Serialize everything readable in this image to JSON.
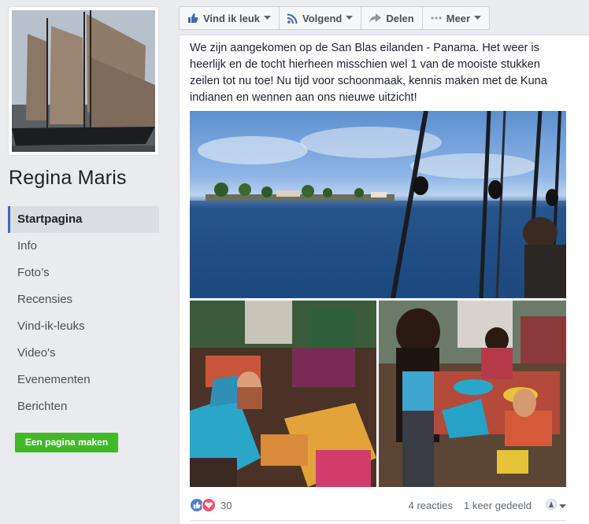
{
  "page": {
    "name": "Regina Maris"
  },
  "sidebar": {
    "items": [
      {
        "label": "Startpagina",
        "active": true
      },
      {
        "label": "Info"
      },
      {
        "label": "Foto’s"
      },
      {
        "label": "Recensies"
      },
      {
        "label": "Vind-ik-leuks"
      },
      {
        "label": "Video's"
      },
      {
        "label": "Evenementen"
      },
      {
        "label": "Berichten"
      }
    ],
    "create_button": "Een pagina maken"
  },
  "actionbar": {
    "like": "Vind ik leuk",
    "follow": "Volgend",
    "share": "Delen",
    "more": "Meer"
  },
  "post": {
    "text": "We zijn aangekomen op de San Blas eilanden - Panama. Het weer is heerlijk en de tocht hierheen misschien wel 1 van de mooiste stukken zeilen tot nu toe! Nu tijd voor schoonmaak, kennis maken met de Kuna indianen en wennen aan ons nieuwe uitzicht!",
    "reaction_count": "30",
    "comments": "4 reacties",
    "shares": "1 keer gedeeld"
  },
  "colors": {
    "brand_blue": "#4267b2",
    "create_green": "#42b72a",
    "like_blue": "#4e7bd9",
    "love_red": "#f25268"
  },
  "icons": {
    "like": "thumbs-up-icon",
    "follow": "rss-icon",
    "share": "share-arrow-icon",
    "more": "ellipsis-icon",
    "caret": "caret-down-icon"
  }
}
